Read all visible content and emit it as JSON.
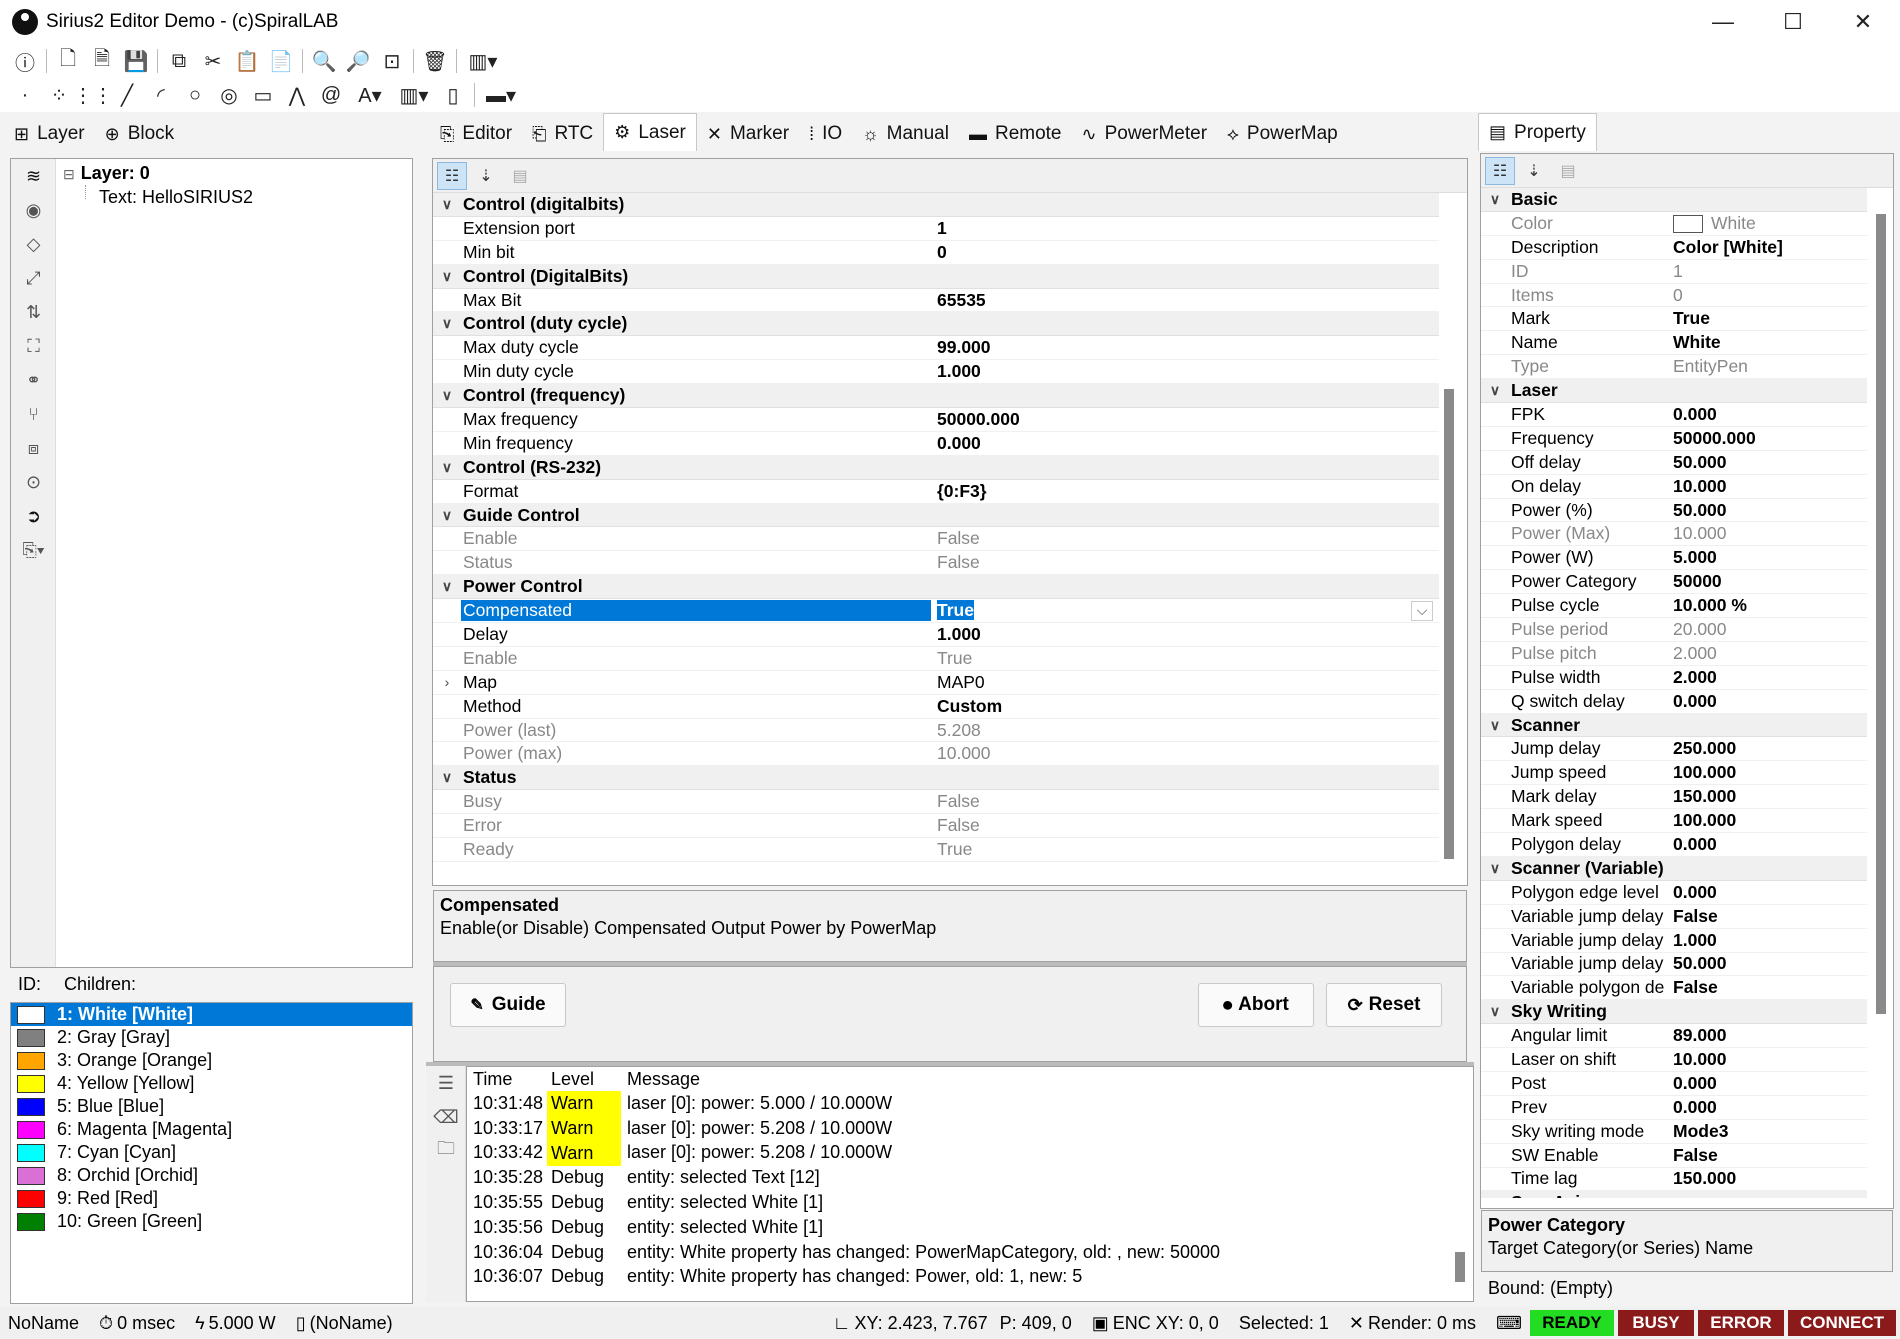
{
  "window": {
    "title": "Sirius2 Editor Demo - (c)SpiralLAB",
    "minimize": "—",
    "maximize": "☐",
    "close": "✕"
  },
  "left_tabs": [
    {
      "label": "Layer",
      "icon": "layer-tree-icon"
    },
    {
      "label": "Block",
      "icon": "block-icon"
    }
  ],
  "layer_tree": {
    "root": "Layer: 0",
    "child": "Text: HelloSIRIUS2",
    "expander": "⊟"
  },
  "pen_header": {
    "id": "ID:",
    "children": "Children:"
  },
  "pens": [
    {
      "label": "1: White [White]",
      "color": "#ffffff"
    },
    {
      "label": "2: Gray [Gray]",
      "color": "#808080"
    },
    {
      "label": "3: Orange [Orange]",
      "color": "#ffa500"
    },
    {
      "label": "4: Yellow [Yellow]",
      "color": "#ffff00"
    },
    {
      "label": "5: Blue [Blue]",
      "color": "#0000ff"
    },
    {
      "label": "6: Magenta [Magenta]",
      "color": "#ff00ff"
    },
    {
      "label": "7: Cyan [Cyan]",
      "color": "#00ffff"
    },
    {
      "label": "8: Orchid [Orchid]",
      "color": "#da70d6"
    },
    {
      "label": "9: Red [Red]",
      "color": "#ff0000"
    },
    {
      "label": "10: Green [Green]",
      "color": "#008000"
    }
  ],
  "center_tabs": [
    {
      "label": "Editor",
      "icon": "editor-icon"
    },
    {
      "label": "RTC",
      "icon": "rtc-icon"
    },
    {
      "label": "Laser",
      "icon": "laser-icon"
    },
    {
      "label": "Marker",
      "icon": "marker-icon"
    },
    {
      "label": "IO",
      "icon": "io-icon"
    },
    {
      "label": "Manual",
      "icon": "manual-icon"
    },
    {
      "label": "Remote",
      "icon": "remote-icon"
    },
    {
      "label": "PowerMeter",
      "icon": "powermeter-icon"
    },
    {
      "label": "PowerMap",
      "icon": "powermap-icon"
    }
  ],
  "laser_grid": [
    {
      "type": "cat",
      "name": "Control (digitalbits)",
      "exp": "∨"
    },
    {
      "name": "Extension port",
      "value": "1"
    },
    {
      "name": "Min bit",
      "value": "0"
    },
    {
      "type": "cat",
      "name": "Control (DigitalBits)",
      "exp": "∨"
    },
    {
      "name": "Max Bit",
      "value": "65535"
    },
    {
      "type": "cat",
      "name": "Control (duty cycle)",
      "exp": "∨"
    },
    {
      "name": "Max duty cycle",
      "value": "99.000"
    },
    {
      "name": "Min duty cycle",
      "value": "1.000"
    },
    {
      "type": "cat",
      "name": "Control (frequency)",
      "exp": "∨"
    },
    {
      "name": "Max frequency",
      "value": "50000.000"
    },
    {
      "name": "Min frequency",
      "value": "0.000"
    },
    {
      "type": "cat",
      "name": "Control (RS-232)",
      "exp": "∨"
    },
    {
      "name": "Format",
      "value": "{0:F3}"
    },
    {
      "type": "cat",
      "name": "Guide Control",
      "exp": "∨"
    },
    {
      "name": "Enable",
      "value": "False",
      "ro": true
    },
    {
      "name": "Status",
      "value": "False",
      "ro": true
    },
    {
      "type": "cat",
      "name": "Power Control",
      "exp": "∨"
    },
    {
      "name": "Compensated",
      "value": "True",
      "sel": true
    },
    {
      "name": "Delay",
      "value": "1.000"
    },
    {
      "name": "Enable",
      "value": "True",
      "ro": true
    },
    {
      "name": "Map",
      "value": "MAP0",
      "exp": "›",
      "plain": true
    },
    {
      "name": "Method",
      "value": "Custom"
    },
    {
      "name": "Power (last)",
      "value": "5.208",
      "ro": true
    },
    {
      "name": "Power (max)",
      "value": "10.000",
      "ro": true
    },
    {
      "type": "cat",
      "name": "Status",
      "exp": "∨"
    },
    {
      "name": "Busy",
      "value": "False",
      "ro": true
    },
    {
      "name": "Error",
      "value": "False",
      "ro": true
    },
    {
      "name": "Ready",
      "value": "True",
      "ro": true
    }
  ],
  "laser_desc": {
    "title": "Compensated",
    "text": "Enable(or Disable) Compensated Output Power by PowerMap"
  },
  "buttons": {
    "guide": "Guide",
    "abort": "Abort",
    "reset": "Reset"
  },
  "log": {
    "headers": {
      "time": "Time",
      "level": "Level",
      "message": "Message"
    },
    "rows": [
      {
        "time": "10:31:48",
        "level": "Warn",
        "message": "laser [0]: power: 5.000 / 10.000W"
      },
      {
        "time": "10:33:17",
        "level": "Warn",
        "message": "laser [0]: power: 5.208 / 10.000W"
      },
      {
        "time": "10:33:42",
        "level": "Warn",
        "message": "laser [0]: power: 5.208 / 10.000W"
      },
      {
        "time": "10:35:28",
        "level": "Debug",
        "message": "entity: selected Text [12]"
      },
      {
        "time": "10:35:55",
        "level": "Debug",
        "message": "entity: selected White [1]"
      },
      {
        "time": "10:35:56",
        "level": "Debug",
        "message": "entity: selected White [1]"
      },
      {
        "time": "10:36:04",
        "level": "Debug",
        "message": "entity: White property has changed: PowerMapCategory, old: , new: 50000"
      },
      {
        "time": "10:36:07",
        "level": "Debug",
        "message": "entity: White property has changed: Power, old: 1, new: 5"
      }
    ]
  },
  "property_tab": "Property",
  "prop_grid": [
    {
      "type": "cat",
      "name": "Basic",
      "exp": "∨"
    },
    {
      "name": "Color",
      "value": "White",
      "ro": true,
      "swatch": true
    },
    {
      "name": "Description",
      "value": "Color [White]"
    },
    {
      "name": "ID",
      "value": "1",
      "ro": true
    },
    {
      "name": "Items",
      "value": "0",
      "ro": true
    },
    {
      "name": "Mark",
      "value": "True"
    },
    {
      "name": "Name",
      "value": "White"
    },
    {
      "name": "Type",
      "value": "EntityPen",
      "ro": true
    },
    {
      "type": "cat",
      "name": "Laser",
      "exp": "∨"
    },
    {
      "name": "FPK",
      "value": "0.000"
    },
    {
      "name": "Frequency",
      "value": "50000.000"
    },
    {
      "name": "Off delay",
      "value": "50.000"
    },
    {
      "name": "On delay",
      "value": "10.000"
    },
    {
      "name": "Power (%)",
      "value": "50.000"
    },
    {
      "name": "Power (Max)",
      "value": "10.000",
      "ro": true
    },
    {
      "name": "Power (W)",
      "value": "5.000"
    },
    {
      "name": "Power Category",
      "value": "50000"
    },
    {
      "name": "Pulse cycle",
      "value": "10.000 %"
    },
    {
      "name": "Pulse period",
      "value": "20.000",
      "ro": true
    },
    {
      "name": "Pulse pitch",
      "value": "2.000",
      "ro": true
    },
    {
      "name": "Pulse width",
      "value": "2.000"
    },
    {
      "name": "Q switch delay",
      "value": "0.000"
    },
    {
      "type": "cat",
      "name": "Scanner",
      "exp": "∨"
    },
    {
      "name": "Jump delay",
      "value": "250.000"
    },
    {
      "name": "Jump speed",
      "value": "100.000"
    },
    {
      "name": "Mark delay",
      "value": "150.000"
    },
    {
      "name": "Mark speed",
      "value": "100.000"
    },
    {
      "name": "Polygon delay",
      "value": "0.000"
    },
    {
      "type": "cat",
      "name": "Scanner (Variable)",
      "exp": "∨"
    },
    {
      "name": "Polygon edge level",
      "value": "0.000"
    },
    {
      "name": "Variable jump delay",
      "value": "False"
    },
    {
      "name": "Variable jump delay",
      "value": "1.000"
    },
    {
      "name": "Variable jump delay",
      "value": "50.000"
    },
    {
      "name": "Variable polygon de",
      "value": "False"
    },
    {
      "type": "cat",
      "name": "Sky Writing",
      "exp": "∨"
    },
    {
      "name": "Angular limit",
      "value": "89.000"
    },
    {
      "name": "Laser on shift",
      "value": "10.000"
    },
    {
      "name": "Post",
      "value": "0.000"
    },
    {
      "name": "Prev",
      "value": "0.000"
    },
    {
      "name": "Sky writing mode",
      "value": "Mode3"
    },
    {
      "name": "SW Enable",
      "value": "False"
    },
    {
      "name": "Time lag",
      "value": "150.000"
    },
    {
      "type": "cat",
      "name": "SyncAxis",
      "exp": "∨"
    }
  ],
  "prop_desc": {
    "title": "Power Category",
    "text": "Target Category(or Series) Name"
  },
  "bound": "Bound: (Empty)",
  "status": {
    "doc": "NoName",
    "time": "0 msec",
    "power": "5.000 W",
    "file": "(NoName)",
    "xy": "XY: 2.423, 7.767",
    "p": "P: 409, 0",
    "enc": "ENC XY: 0, 0",
    "selected": "Selected: 1",
    "render": "Render: 0 ms",
    "ready": "READY",
    "busy": "BUSY",
    "error": "ERROR",
    "connect": "CONNECT",
    "ready_color": "#22dd22",
    "alarm_color": "#8b1a1a"
  }
}
